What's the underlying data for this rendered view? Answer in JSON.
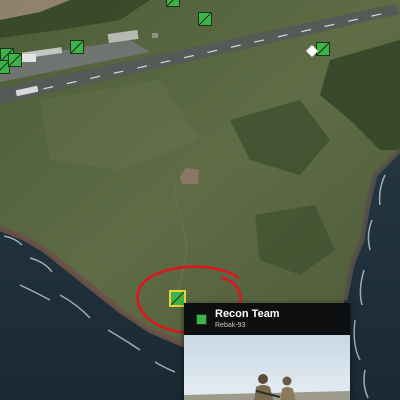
{
  "map": {
    "markers": [
      {
        "name": "squad-marker-1"
      },
      {
        "name": "squad-marker-2"
      },
      {
        "name": "squad-marker-3"
      },
      {
        "name": "squad-marker-4"
      },
      {
        "name": "squad-marker-5"
      },
      {
        "name": "squad-marker-6"
      },
      {
        "name": "squad-marker-7"
      },
      {
        "name": "squad-marker-recon-selected"
      }
    ]
  },
  "tooltip": {
    "title": "Recon Team",
    "subtitle": "Rebak-93"
  },
  "colors": {
    "marker_green": "#3fb24a",
    "annotation_red": "#e0141e",
    "tooltip_bg": "#0e0f10"
  }
}
